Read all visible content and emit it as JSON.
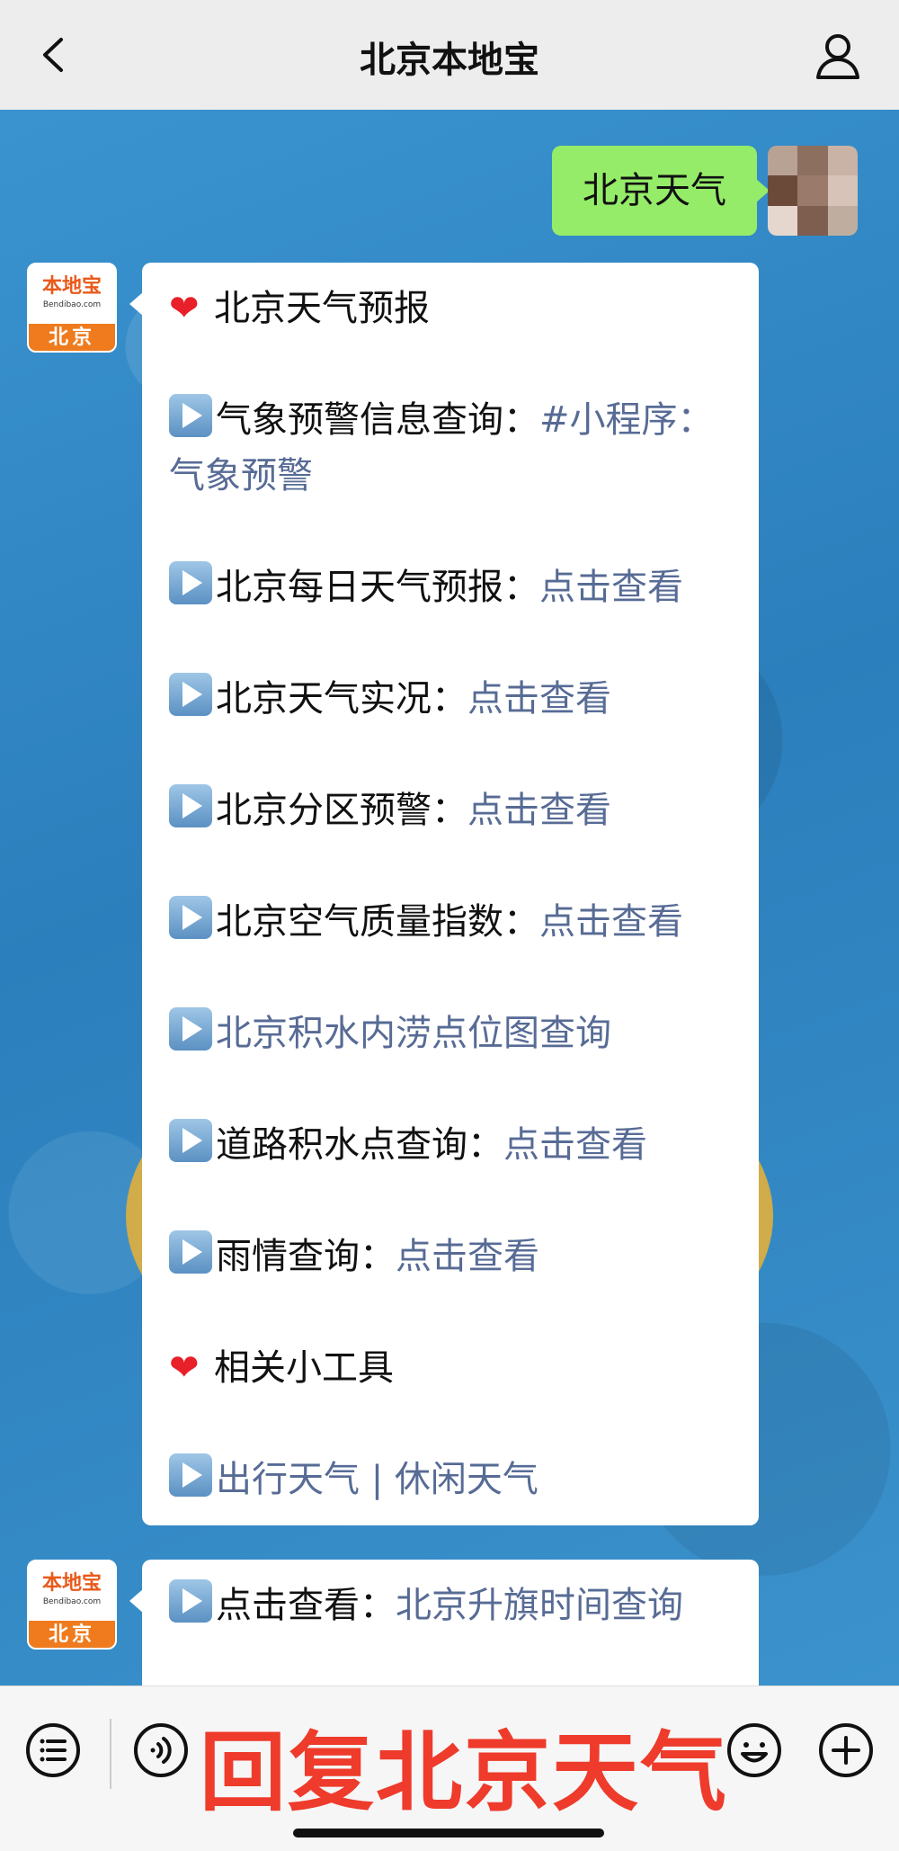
{
  "header": {
    "title": "北京本地宝",
    "back_icon": "chevron-left-icon",
    "profile_icon": "user-icon"
  },
  "sent_message": {
    "text": "北京天气"
  },
  "bot_avatar": {
    "brand": "本地宝",
    "domain": "Bendibao.com",
    "city": "北京"
  },
  "weather_message": {
    "items": [
      {
        "type": "heart",
        "text": "北京天气预报",
        "link": ""
      },
      {
        "type": "play",
        "text": "气象预警信息查询：",
        "link": "#小程序：气象预警"
      },
      {
        "type": "play",
        "text": "北京每日天气预报：",
        "link": "点击查看"
      },
      {
        "type": "play",
        "text": "北京天气实况：",
        "link": "点击查看"
      },
      {
        "type": "play",
        "text": "北京分区预警：",
        "link": "点击查看"
      },
      {
        "type": "play",
        "text": "北京空气质量指数：",
        "link": "点击查看"
      },
      {
        "type": "play",
        "text": "",
        "link": "北京积水内涝点位图查询"
      },
      {
        "type": "play",
        "text": "道路积水点查询：",
        "link": "点击查看"
      },
      {
        "type": "play",
        "text": "雨情查询：",
        "link": "点击查看"
      },
      {
        "type": "heart",
        "text": "相关小工具",
        "link": ""
      },
      {
        "type": "play",
        "text": "",
        "link": "出行天气 | 休闲天气"
      }
    ]
  },
  "second_message": {
    "text": "点击查看：",
    "link": "北京升旗时间查询"
  },
  "bottom_bar": {
    "menu_icon": "list-menu-icon",
    "voice_icon": "voice-icon",
    "emoji_icon": "emoji-icon",
    "plus_icon": "plus-icon",
    "overlay_caption": "回复北京天气"
  },
  "colors": {
    "sent_bubble": "#95ec69",
    "link": "#576b95",
    "caption": "#ee3b2b",
    "avatar_orange": "#ef7b1e"
  }
}
